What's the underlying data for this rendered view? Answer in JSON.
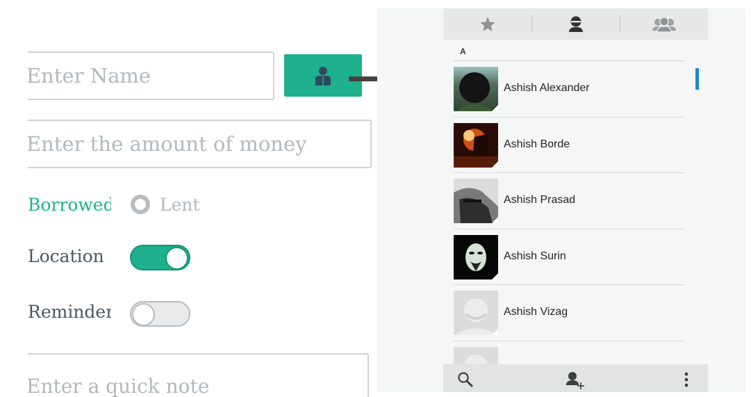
{
  "form": {
    "name_placeholder": "Enter Name",
    "money_placeholder": "Enter the amount of money",
    "borrowed_label": "Borrowed",
    "lent_label": "Lent",
    "location_label": "Location",
    "reminder_label": "Reminder",
    "note_placeholder": "Enter a quick note",
    "location_on": true,
    "reminder_on": false
  },
  "contacts_app": {
    "tabs": [
      "favorites-icon",
      "contacts-icon",
      "groups-icon"
    ],
    "section_letter": "A",
    "contacts": [
      {
        "name": "Ashish Alexander"
      },
      {
        "name": "Ashish Borde"
      },
      {
        "name": "Ashish Prasad"
      },
      {
        "name": "Ashish Surin"
      },
      {
        "name": "Ashish Vizag"
      }
    ],
    "bottom_actions": [
      "search-icon",
      "add-contact-icon",
      "more-options-icon"
    ]
  },
  "colors": {
    "accent": "#1fb08e",
    "scroll_indicator": "#1e88cc",
    "placeholder": "#b3b8bc",
    "label_text": "#4a5660"
  }
}
